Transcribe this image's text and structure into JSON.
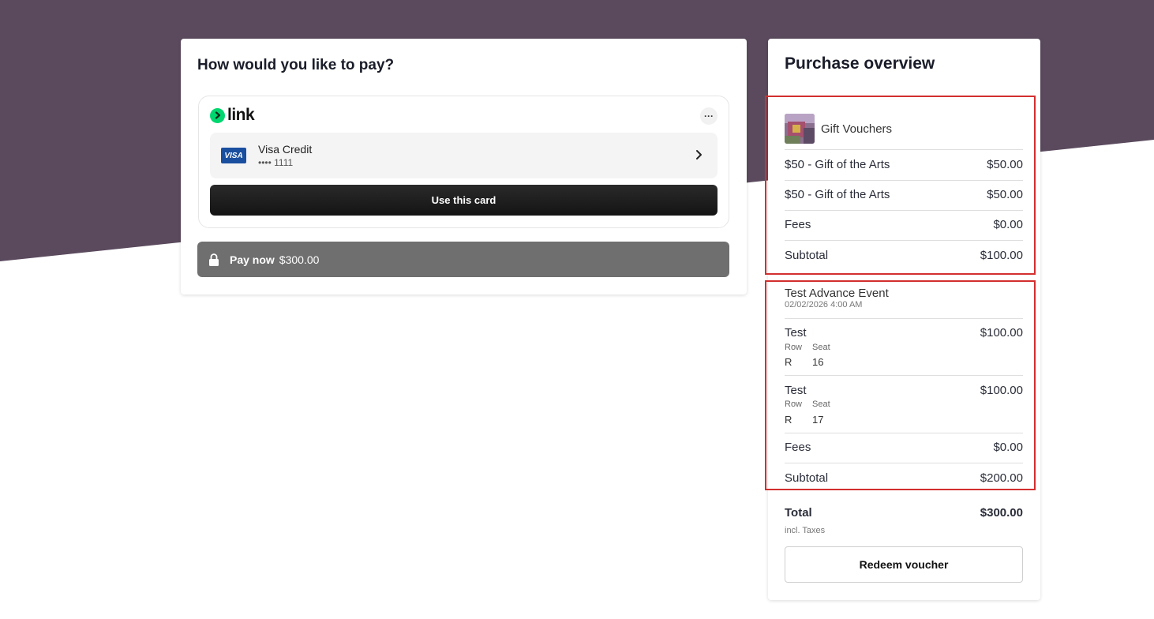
{
  "colors": {
    "header_bg": "#5b4a5e",
    "accent_link": "#00d66f",
    "highlight_border": "#d32f2f"
  },
  "payment": {
    "title": "How would you like to pay?",
    "link_wordmark": "link",
    "more_label": "···",
    "card_brand": "VISA",
    "card_name": "Visa Credit",
    "card_number": "•••• 1111",
    "use_card_label": "Use this card",
    "pay_now_label": "Pay now",
    "pay_now_amount": "$300.00"
  },
  "overview": {
    "title": "Purchase overview",
    "gift_section": {
      "heading": "Gift Vouchers",
      "items": [
        {
          "name": "$50 - Gift of the Arts",
          "price": "$50.00"
        },
        {
          "name": "$50 - Gift of the Arts",
          "price": "$50.00"
        }
      ],
      "fees_label": "Fees",
      "fees": "$0.00",
      "subtotal_label": "Subtotal",
      "subtotal": "$100.00"
    },
    "event_section": {
      "event_name": "Test Advance Event",
      "event_date": "02/02/2026 4:00 AM",
      "tickets": [
        {
          "name": "Test",
          "price": "$100.00",
          "row_label": "Row",
          "seat_label": "Seat",
          "row": "R",
          "seat": "16"
        },
        {
          "name": "Test",
          "price": "$100.00",
          "row_label": "Row",
          "seat_label": "Seat",
          "row": "R",
          "seat": "17"
        }
      ],
      "fees_label": "Fees",
      "fees": "$0.00",
      "subtotal_label": "Subtotal",
      "subtotal": "$200.00"
    },
    "total_label": "Total",
    "total": "$300.00",
    "taxes_note": "incl. Taxes",
    "redeem_label": "Redeem voucher"
  }
}
